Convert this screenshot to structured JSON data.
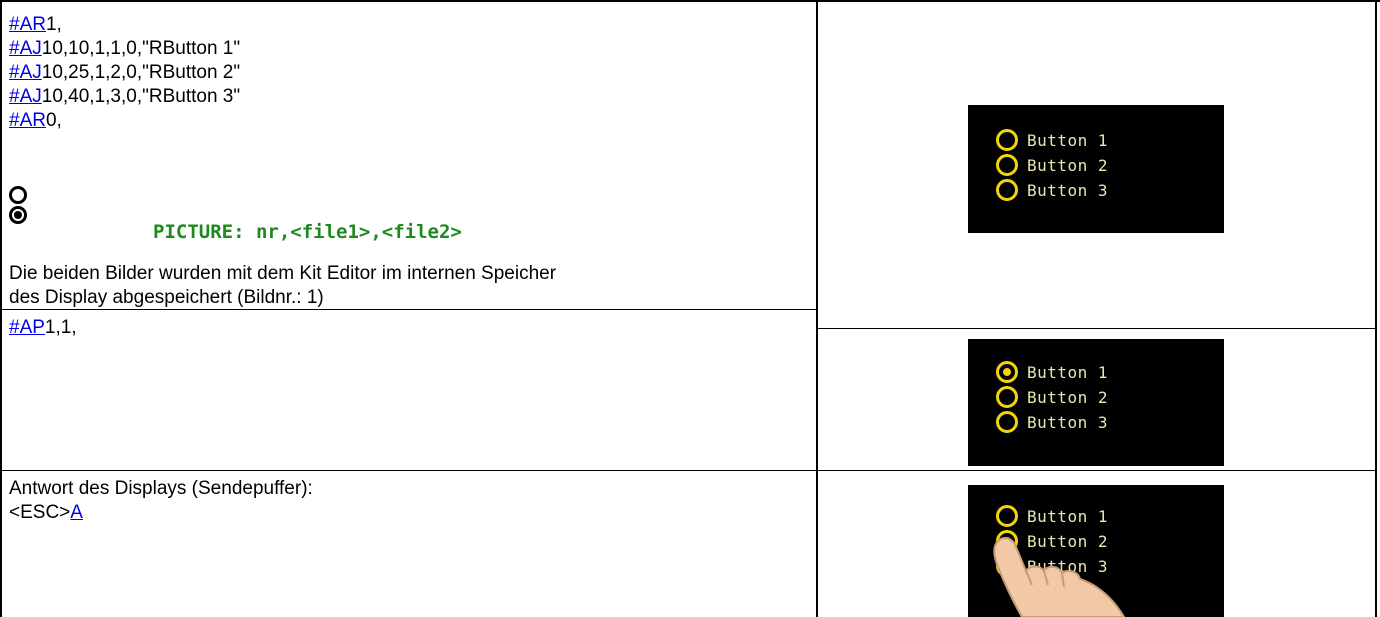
{
  "left": {
    "code_block_1": [
      {
        "cmd": "#AR",
        "rest": "1,"
      },
      {
        "cmd": "#AJ",
        "rest": "10,10,1,1,0,\"RButton 1\""
      },
      {
        "cmd": "#AJ",
        "rest": "10,25,1,2,0,\"RButton 2\""
      },
      {
        "cmd": "#AJ",
        "rest": "10,40,1,3,0,\"RButton 3\""
      },
      {
        "cmd": "#AR",
        "rest": "0,"
      }
    ],
    "picture_label": "PICTURE: nr,<file1>,<file2>",
    "description_line1": "Die beiden Bilder wurden mit dem Kit Editor im internen Speicher",
    "description_line2": "des Display abgespeichert (Bildnr.: 1)",
    "code_block_2": {
      "cmd": "#AP",
      "rest": "1,1,"
    },
    "response_line1": "Antwort des Displays (Sendepuffer):",
    "response_prefix": "<ESC>",
    "response_link": "A"
  },
  "screens": [
    {
      "buttons": [
        {
          "label": "Button 1",
          "selected": false
        },
        {
          "label": "Button 2",
          "selected": false
        },
        {
          "label": "Button 3",
          "selected": false
        }
      ]
    },
    {
      "buttons": [
        {
          "label": "Button 1",
          "selected": true
        },
        {
          "label": "Button 2",
          "selected": false
        },
        {
          "label": "Button 3",
          "selected": false
        }
      ]
    },
    {
      "buttons": [
        {
          "label": "Button 1",
          "selected": false
        },
        {
          "label": "Button 2",
          "selected": true
        },
        {
          "label": "Button 3",
          "selected": false
        }
      ],
      "touch_hand": true
    }
  ],
  "colors": {
    "link": "#0000ee",
    "picture_label": "#1e8a1e",
    "radio_yellow": "#f3d30c",
    "screen_bg": "#000000"
  }
}
